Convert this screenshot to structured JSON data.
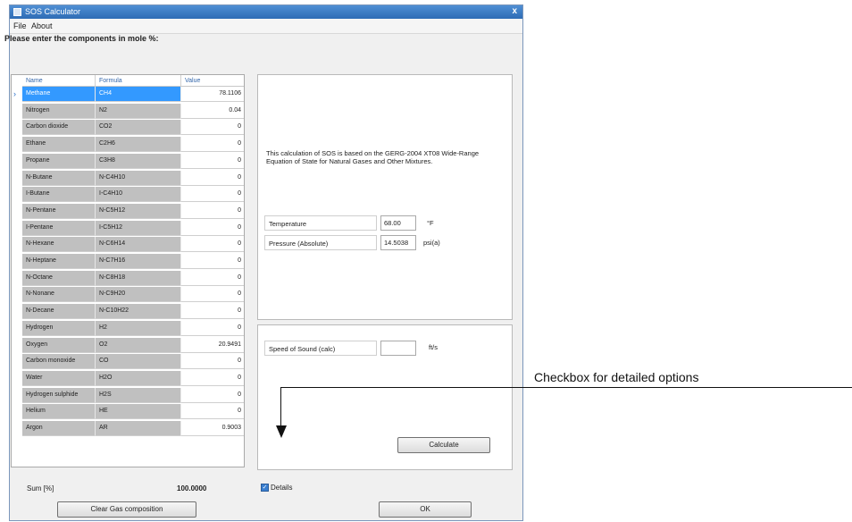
{
  "window": {
    "title": "SOS Calculator",
    "close": "x"
  },
  "menu": {
    "items": [
      "File",
      "About"
    ]
  },
  "instruction": "Please enter the components in mole %:",
  "grid": {
    "columns": [
      "Name",
      "Formula",
      "Value"
    ],
    "rows": [
      {
        "name": "Methane",
        "formula": "CH4",
        "value": "78.1106"
      },
      {
        "name": "Nitrogen",
        "formula": "N2",
        "value": "0.04"
      },
      {
        "name": "Carbon dioxide",
        "formula": "CO2",
        "value": "0"
      },
      {
        "name": "Ethane",
        "formula": "C2H6",
        "value": "0"
      },
      {
        "name": "Propane",
        "formula": "C3H8",
        "value": "0"
      },
      {
        "name": "N-Butane",
        "formula": "N-C4H10",
        "value": "0"
      },
      {
        "name": "I-Butane",
        "formula": "I-C4H10",
        "value": "0"
      },
      {
        "name": "N-Pentane",
        "formula": "N-C5H12",
        "value": "0"
      },
      {
        "name": "I-Pentane",
        "formula": "I-C5H12",
        "value": "0"
      },
      {
        "name": "N-Hexane",
        "formula": "N-C6H14",
        "value": "0"
      },
      {
        "name": "N-Heptane",
        "formula": "N-C7H16",
        "value": "0"
      },
      {
        "name": "N-Octane",
        "formula": "N-C8H18",
        "value": "0"
      },
      {
        "name": "N-Nonane",
        "formula": "N-C9H20",
        "value": "0"
      },
      {
        "name": "N-Decane",
        "formula": "N-C10H22",
        "value": "0"
      },
      {
        "name": "Hydrogen",
        "formula": "H2",
        "value": "0"
      },
      {
        "name": "Oxygen",
        "formula": "O2",
        "value": "20.9491"
      },
      {
        "name": "Carbon monoxide",
        "formula": "CO",
        "value": "0"
      },
      {
        "name": "Water",
        "formula": "H2O",
        "value": "0"
      },
      {
        "name": "Hydrogen sulphide",
        "formula": "H2S",
        "value": "0"
      },
      {
        "name": "Helium",
        "formula": "HE",
        "value": "0"
      },
      {
        "name": "Argon",
        "formula": "AR",
        "value": "0.9003"
      }
    ],
    "selected_row": 0,
    "row_marker": "›"
  },
  "info_text": "This calculation of SOS is based on the GERG-2004 XT08 Wide-Range Equation of State for Natural Gases and Other Mixtures.",
  "temperature": {
    "label": "Temperature",
    "value": "68.00",
    "unit": "°F"
  },
  "pressure": {
    "label": "Pressure (Absolute)",
    "value": "14.5038",
    "unit": "psi(a)"
  },
  "speed": {
    "label": "Speed of Sound (calc)",
    "value": "",
    "unit": "ft/s"
  },
  "buttons": {
    "calculate": "Calculate",
    "clear": "Clear Gas composition",
    "ok": "OK"
  },
  "sum": {
    "label": "Sum [%]",
    "value": "100.0000"
  },
  "details": {
    "label": "Details",
    "checked": true
  },
  "callout": "Checkbox for detailed options",
  "colors": {
    "title_bar": "#2e6cb5",
    "selection": "#3399ff",
    "readonly_cell": "#c0c0c0"
  }
}
